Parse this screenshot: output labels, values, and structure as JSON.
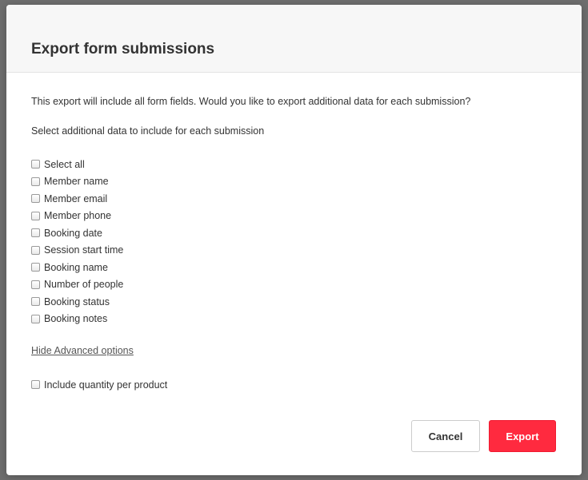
{
  "dialog": {
    "title": "Export form submissions",
    "intro": "This export will include all form fields. Would you like to export additional data for each submission?",
    "select_prompt": "Select additional data to include for each submission",
    "options": [
      {
        "label": "Select all",
        "checked": false
      },
      {
        "label": "Member name",
        "checked": false
      },
      {
        "label": "Member email",
        "checked": false
      },
      {
        "label": "Member phone",
        "checked": false
      },
      {
        "label": "Booking date",
        "checked": false
      },
      {
        "label": "Session start time",
        "checked": false
      },
      {
        "label": "Booking name",
        "checked": false
      },
      {
        "label": "Number of people",
        "checked": false
      },
      {
        "label": "Booking status",
        "checked": false
      },
      {
        "label": "Booking notes",
        "checked": false
      }
    ],
    "advanced_link": "Hide Advanced options",
    "advanced_options": [
      {
        "label": "Include quantity per product",
        "checked": false
      }
    ],
    "buttons": {
      "cancel": "Cancel",
      "export": "Export"
    }
  },
  "colors": {
    "export_button": "#ff2a3f",
    "header_background": "#f7f7f7",
    "backdrop": "#6e6e6e"
  }
}
